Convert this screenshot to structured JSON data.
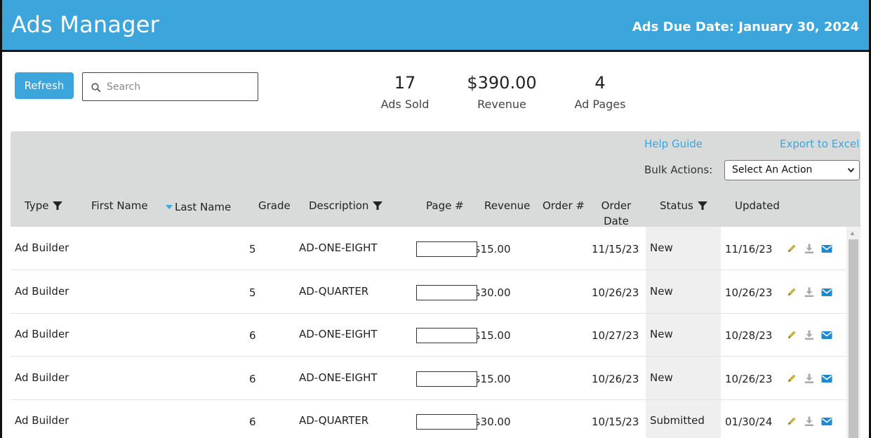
{
  "header": {
    "title": "Ads Manager",
    "due_date": "Ads Due Date: January 30, 2024",
    "accent_color": "#3ba5dc"
  },
  "toolbar": {
    "refresh_label": "Refresh",
    "search_placeholder": "Search",
    "search_value": ""
  },
  "stats": [
    {
      "value": "17",
      "label": "Ads Sold"
    },
    {
      "value": "$390.00",
      "label": "Revenue"
    },
    {
      "value": "4",
      "label": "Ad Pages"
    }
  ],
  "panel": {
    "help_label": "Help Guide",
    "export_label": "Export to Excel",
    "bulk_label": "Bulk Actions:",
    "bulk_selected": "Select An Action"
  },
  "columns": {
    "type": "Type",
    "first_name": "First Name",
    "last_name": "Last Name",
    "grade": "Grade",
    "description": "Description",
    "page": "Page #",
    "revenue": "Revenue",
    "order_num": "Order #",
    "order_date_1": "Order",
    "order_date_2": "Date",
    "status": "Status",
    "updated": "Updated"
  },
  "icons": {
    "filter": "filter-icon",
    "sort": "sort-desc-icon",
    "search": "search-icon",
    "edit": "pencil-icon",
    "download": "download-icon",
    "email": "envelope-icon"
  },
  "rows": [
    {
      "type": "Ad Builder",
      "first": "",
      "last": "",
      "grade": "5",
      "desc": "AD-ONE-EIGHT",
      "page": "",
      "revenue": "$15.00",
      "order": "",
      "date": "11/15/23",
      "status": "New",
      "updated": "11/16/23"
    },
    {
      "type": "Ad Builder",
      "first": "",
      "last": "",
      "grade": "5",
      "desc": "AD-QUARTER",
      "page": "",
      "revenue": "$30.00",
      "order": "",
      "date": "10/26/23",
      "status": "New",
      "updated": "10/26/23"
    },
    {
      "type": "Ad Builder",
      "first": "",
      "last": "",
      "grade": "6",
      "desc": "AD-ONE-EIGHT",
      "page": "",
      "revenue": "$15.00",
      "order": "",
      "date": "10/27/23",
      "status": "New",
      "updated": "10/28/23"
    },
    {
      "type": "Ad Builder",
      "first": "",
      "last": "",
      "grade": "6",
      "desc": "AD-ONE-EIGHT",
      "page": "",
      "revenue": "$15.00",
      "order": "",
      "date": "10/26/23",
      "status": "New",
      "updated": "10/26/23"
    },
    {
      "type": "Ad Builder",
      "first": "",
      "last": "",
      "grade": "6",
      "desc": "AD-QUARTER",
      "page": "",
      "revenue": "$30.00",
      "order": "",
      "date": "10/15/23",
      "status": "Submitted",
      "updated": "01/30/24"
    }
  ]
}
